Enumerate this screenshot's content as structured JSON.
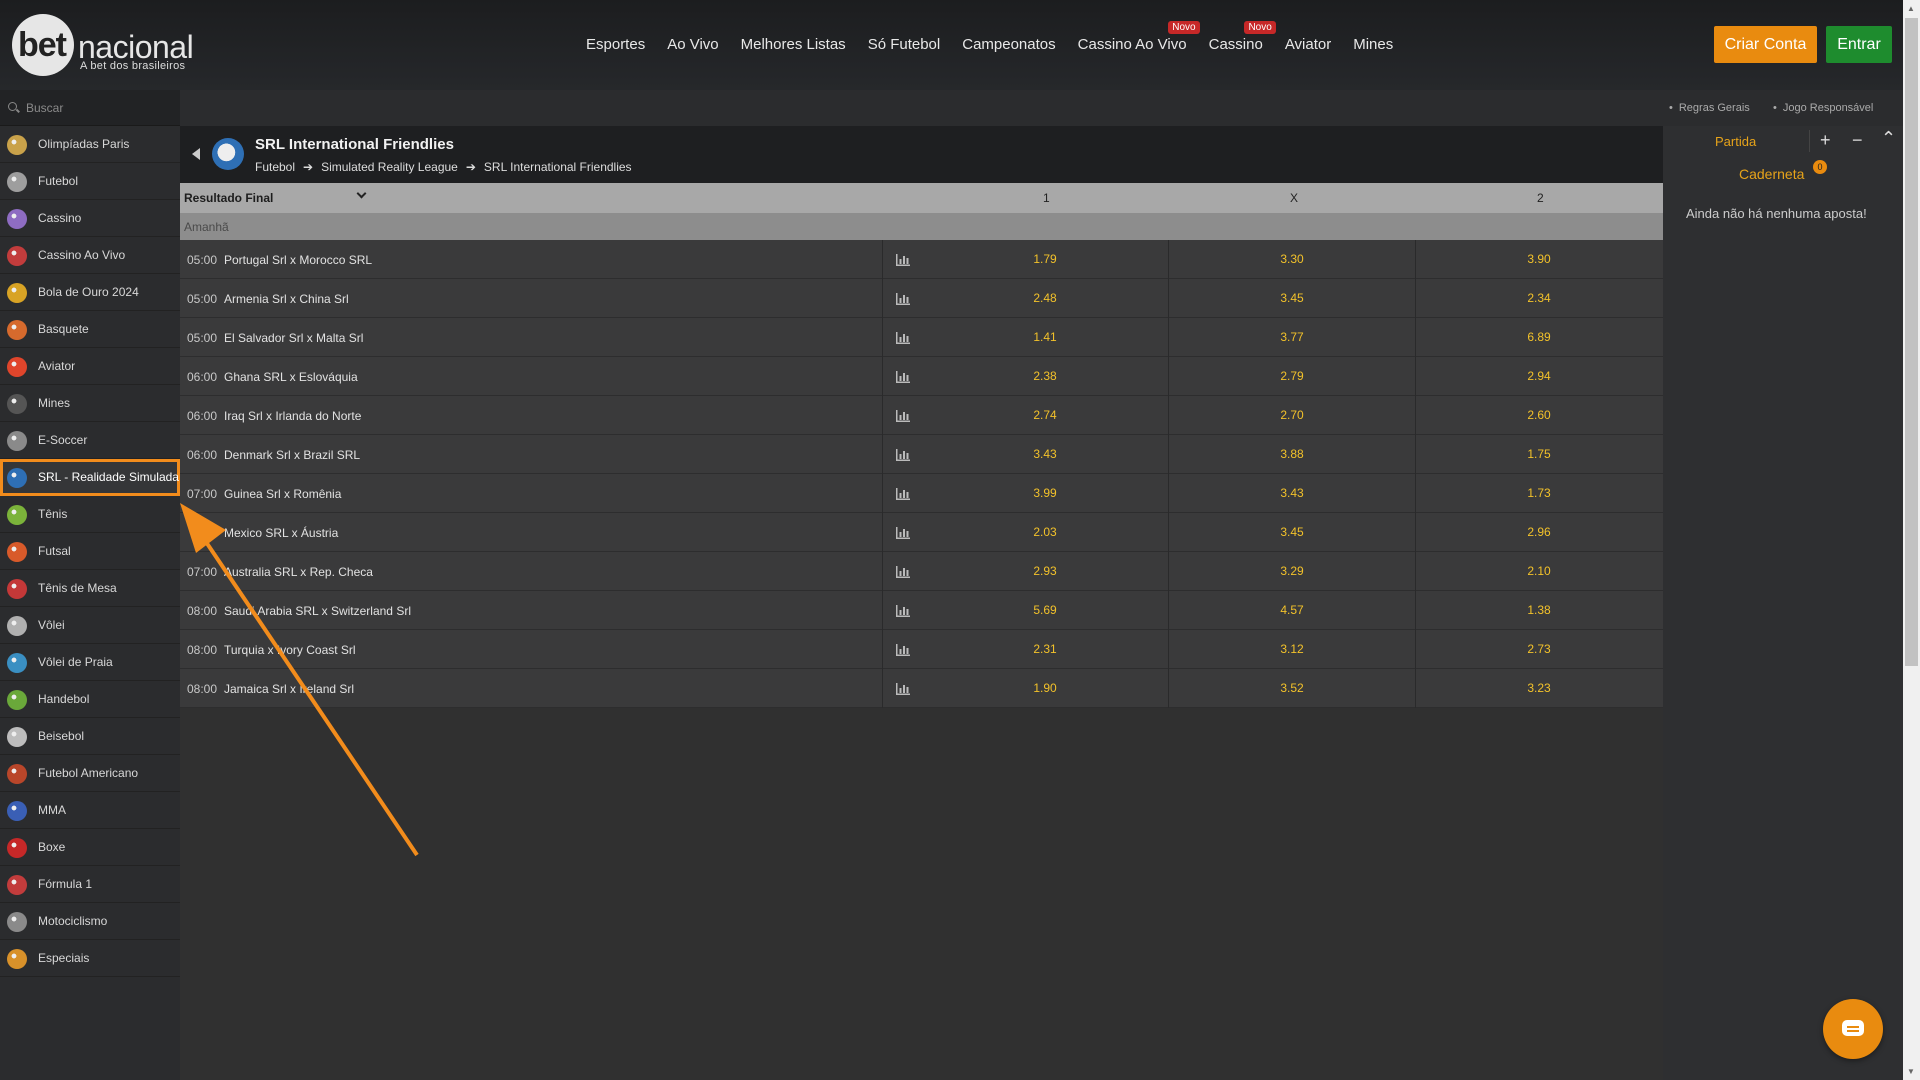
{
  "brand": {
    "logo_bet": "bet",
    "logo_nacional": "nacional",
    "tagline": "A bet dos brasileiros"
  },
  "nav": [
    {
      "label": "Esportes",
      "badge": ""
    },
    {
      "label": "Ao Vivo",
      "badge": ""
    },
    {
      "label": "Melhores Listas",
      "badge": ""
    },
    {
      "label": "Só Futebol",
      "badge": ""
    },
    {
      "label": "Campeonatos",
      "badge": ""
    },
    {
      "label": "Cassino Ao Vivo",
      "badge": "Novo"
    },
    {
      "label": "Cassino",
      "badge": "Novo"
    },
    {
      "label": "Aviator",
      "badge": ""
    },
    {
      "label": "Mines",
      "badge": ""
    }
  ],
  "auth": {
    "signup": "Criar Conta",
    "login": "Entrar"
  },
  "search": {
    "placeholder": "Buscar"
  },
  "sidebar": {
    "items": [
      {
        "label": "Olimpíadas Paris",
        "icon": "olympics-icon",
        "color": "#c9a24a"
      },
      {
        "label": "Futebol",
        "icon": "soccer-ball-icon",
        "color": "#9e9e9e"
      },
      {
        "label": "Cassino",
        "icon": "casino-chip-icon",
        "color": "#8e6cc2"
      },
      {
        "label": "Cassino Ao Vivo",
        "icon": "live-casino-icon",
        "color": "#c23c3c"
      },
      {
        "label": "Bola de Ouro 2024",
        "icon": "golden-ball-icon",
        "color": "#d8a325"
      },
      {
        "label": "Basquete",
        "icon": "basketball-icon",
        "color": "#d66a2d"
      },
      {
        "label": "Aviator",
        "icon": "airplane-icon",
        "color": "#e0452b"
      },
      {
        "label": "Mines",
        "icon": "mine-icon",
        "color": "#555555"
      },
      {
        "label": "E-Soccer",
        "icon": "gamepad-icon",
        "color": "#8a8a8a"
      },
      {
        "label": "SRL - Realidade Simulada",
        "icon": "srl-globe-icon",
        "color": "#2e6fb5",
        "active": true
      },
      {
        "label": "Tênis",
        "icon": "tennis-ball-icon",
        "color": "#7bb33a"
      },
      {
        "label": "Futsal",
        "icon": "futsal-ball-icon",
        "color": "#d85a2a"
      },
      {
        "label": "Tênis de Mesa",
        "icon": "table-tennis-icon",
        "color": "#c43838"
      },
      {
        "label": "Vôlei",
        "icon": "volleyball-icon",
        "color": "#b0b0b0"
      },
      {
        "label": "Vôlei de Praia",
        "icon": "beach-volleyball-icon",
        "color": "#3a8fc2"
      },
      {
        "label": "Handebol",
        "icon": "handball-icon",
        "color": "#6aa83a"
      },
      {
        "label": "Beisebol",
        "icon": "baseball-icon",
        "color": "#bdbdbd"
      },
      {
        "label": "Futebol Americano",
        "icon": "american-football-icon",
        "color": "#b9462a"
      },
      {
        "label": "MMA",
        "icon": "mma-glove-icon",
        "color": "#3a5fb5"
      },
      {
        "label": "Boxe",
        "icon": "boxing-glove-icon",
        "color": "#c62828"
      },
      {
        "label": "Fórmula 1",
        "icon": "race-car-icon",
        "color": "#c23c3c"
      },
      {
        "label": "Motociclismo",
        "icon": "motorcycle-icon",
        "color": "#8a8a8a"
      },
      {
        "label": "Especiais",
        "icon": "specials-coin-icon",
        "color": "#d8912a"
      }
    ]
  },
  "sublinks": {
    "rules": "Regras Gerais",
    "responsible": "Jogo Responsável"
  },
  "event": {
    "title": "SRL International Friendlies",
    "breadcrumb": [
      "Futebol",
      "Simulated Reality League",
      "SRL International Friendlies"
    ]
  },
  "table": {
    "market": "Resultado Final",
    "col1": "1",
    "colx": "X",
    "col2": "2",
    "day": "Amanhã",
    "rows": [
      {
        "time": "05:00",
        "teams": "Portugal Srl x Morocco SRL",
        "o1": "1.79",
        "ox": "3.30",
        "o2": "3.90"
      },
      {
        "time": "05:00",
        "teams": "Armenia Srl x China Srl",
        "o1": "2.48",
        "ox": "3.45",
        "o2": "2.34"
      },
      {
        "time": "05:00",
        "teams": "El Salvador Srl x Malta Srl",
        "o1": "1.41",
        "ox": "3.77",
        "o2": "6.89"
      },
      {
        "time": "06:00",
        "teams": "Ghana SRL x Eslováquia",
        "o1": "2.38",
        "ox": "2.79",
        "o2": "2.94"
      },
      {
        "time": "06:00",
        "teams": "Iraq Srl x Irlanda do Norte",
        "o1": "2.74",
        "ox": "2.70",
        "o2": "2.60"
      },
      {
        "time": "06:00",
        "teams": "Denmark Srl x Brazil SRL",
        "o1": "3.43",
        "ox": "3.88",
        "o2": "1.75"
      },
      {
        "time": "07:00",
        "teams": "Guinea Srl x Romênia",
        "o1": "3.99",
        "ox": "3.43",
        "o2": "1.73"
      },
      {
        "time": "",
        "teams": "Mexico SRL x Áustria",
        "o1": "2.03",
        "ox": "3.45",
        "o2": "2.96"
      },
      {
        "time": "07:00",
        "teams": "Australia SRL x Rep. Checa",
        "o1": "2.93",
        "ox": "3.29",
        "o2": "2.10"
      },
      {
        "time": "08:00",
        "teams": "Saudi Arabia SRL x Switzerland Srl",
        "o1": "5.69",
        "ox": "4.57",
        "o2": "1.38"
      },
      {
        "time": "08:00",
        "teams": "Turquia x Ivory Coast Srl",
        "o1": "2.31",
        "ox": "3.12",
        "o2": "2.73"
      },
      {
        "time": "08:00",
        "teams": "Jamaica Srl x Ireland Srl",
        "o1": "1.90",
        "ox": "3.52",
        "o2": "3.23"
      }
    ]
  },
  "betslip": {
    "tab": "Partida",
    "title": "Caderneta",
    "count": "0",
    "empty": "Ainda não há nenhuma aposta!"
  },
  "colors": {
    "accent": "#e98b0f",
    "login": "#1e8c2e",
    "odds": "#f3c22a",
    "highlight": "#f28c1c",
    "badge": "#c62828"
  }
}
